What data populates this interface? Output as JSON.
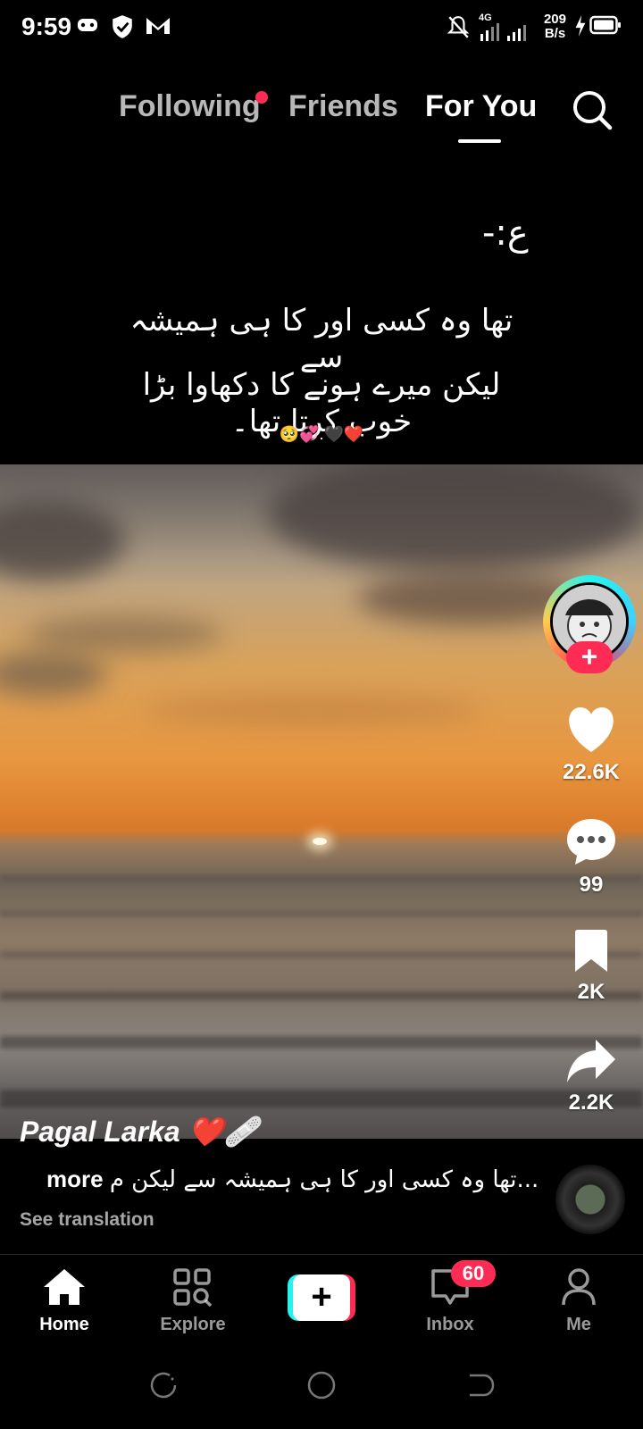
{
  "status_bar": {
    "time": "9:59",
    "network": "4G",
    "speed_value": "209",
    "speed_unit": "B/s",
    "icons": [
      "gamepad-icon",
      "shield-icon",
      "gmail-icon",
      "mute-icon",
      "signal-icon",
      "charging-icon",
      "battery-icon"
    ]
  },
  "top_nav": {
    "tabs": [
      {
        "label": "Following",
        "active": false,
        "has_dot": true
      },
      {
        "label": "Friends",
        "active": false
      },
      {
        "label": "For You",
        "active": true
      }
    ],
    "search_icon": "search-icon"
  },
  "post_header": {
    "mark": "ع:-",
    "line1": "تھا وہ کسی اور کا ہی ہمیشہ سے",
    "line2": "لیکن میرے ہونے کا دکھاوا بڑا خوب کرتا تھا۔",
    "emojis": "🥺💞.🖤❤️"
  },
  "actions": {
    "likes": "22.6K",
    "comments": "99",
    "saves": "2K",
    "shares": "2.2K"
  },
  "post": {
    "author": "Pagal Larka ❤️🩹",
    "caption": "تھا وہ کسی اور کا ہی ہمیشہ سے لیکن م...",
    "more": "more",
    "see_translation": "See translation"
  },
  "bottom_nav": {
    "items": [
      {
        "label": "Home",
        "icon": "home-icon",
        "active": true
      },
      {
        "label": "Explore",
        "icon": "explore-icon",
        "active": false
      },
      {
        "label": "Inbox",
        "icon": "inbox-icon",
        "active": false,
        "badge": "60"
      },
      {
        "label": "Me",
        "icon": "profile-icon",
        "active": false
      }
    ]
  },
  "colors": {
    "accent": "#fe2c55",
    "cyan": "#25f4ee",
    "background": "#000000"
  }
}
